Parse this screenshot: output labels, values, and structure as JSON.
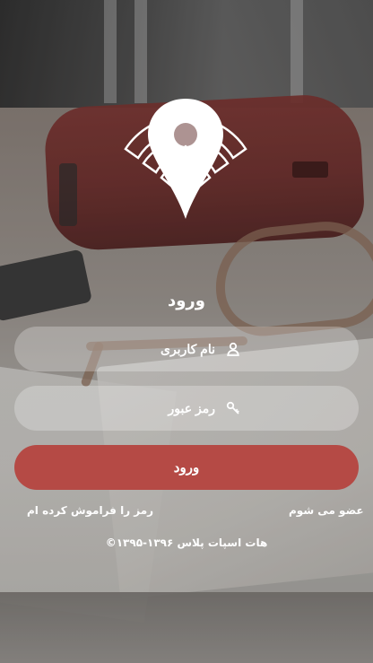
{
  "login": {
    "title": "ورود",
    "username_placeholder": "نام کاربری",
    "password_placeholder": "رمز عبور",
    "submit_label": "ورود",
    "signup_link": "عضو می شوم",
    "forgot_link": "رمز را فراموش کرده ام",
    "footer": "©۱۳۹۵-۱۳۹۶ هات اسپات پلاس"
  },
  "colors": {
    "button": "#b54a45",
    "field_bg": "rgba(255,255,255,0.26)",
    "text": "#ffffff"
  },
  "icons": {
    "logo": "location-pin-wifi-icon",
    "username": "user-icon",
    "password": "key-icon"
  }
}
